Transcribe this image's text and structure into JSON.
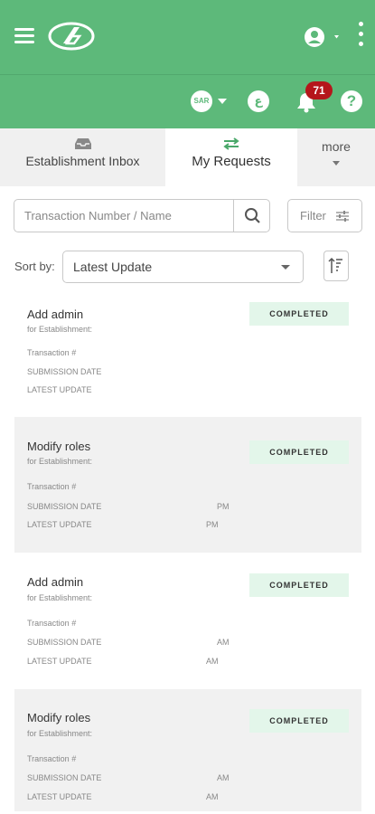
{
  "header": {
    "currency": "SAR",
    "language_icon": "arabic-letter",
    "notifications_count": "71",
    "help_label": "?"
  },
  "tabs": [
    {
      "label": "Establishment Inbox",
      "icon": "inbox-icon",
      "active": false
    },
    {
      "label": "My Requests",
      "icon": "swap-arrows-icon",
      "active": true
    },
    {
      "label": "more",
      "icon": "chevron-down-icon",
      "active": false
    }
  ],
  "search": {
    "placeholder": "Transaction Number / Name",
    "value": ""
  },
  "filter": {
    "label": "Filter"
  },
  "sort": {
    "label": "Sort by:",
    "selected": "Latest Update"
  },
  "cards": [
    {
      "title": "Add admin",
      "subtitle": "for Establishment:",
      "status": "COMPLETED",
      "transaction_label": "Transaction #",
      "submission_label": "SUBMISSION DATE",
      "submission_value": "",
      "latest_label": "LATEST UPDATE",
      "latest_value": ""
    },
    {
      "title": "Modify roles",
      "subtitle": "for Establishment:",
      "status": "COMPLETED",
      "transaction_label": "Transaction #",
      "submission_label": "SUBMISSION DATE",
      "submission_value": "PM",
      "latest_label": "LATEST UPDATE",
      "latest_value": "PM"
    },
    {
      "title": "Add admin",
      "subtitle": "for Establishment:",
      "status": "COMPLETED",
      "transaction_label": "Transaction #",
      "submission_label": "SUBMISSION DATE",
      "submission_value": "AM",
      "latest_label": "LATEST UPDATE",
      "latest_value": "AM"
    },
    {
      "title": "Modify roles",
      "subtitle": "for Establishment:",
      "status": "COMPLETED",
      "transaction_label": "Transaction #",
      "submission_label": "SUBMISSION DATE",
      "submission_value": "AM",
      "latest_label": "LATEST UPDATE",
      "latest_value": "AM"
    }
  ],
  "colors": {
    "brand_green": "#5db97a",
    "status_bg": "#e3f6ea",
    "badge_red": "#b5161b"
  }
}
